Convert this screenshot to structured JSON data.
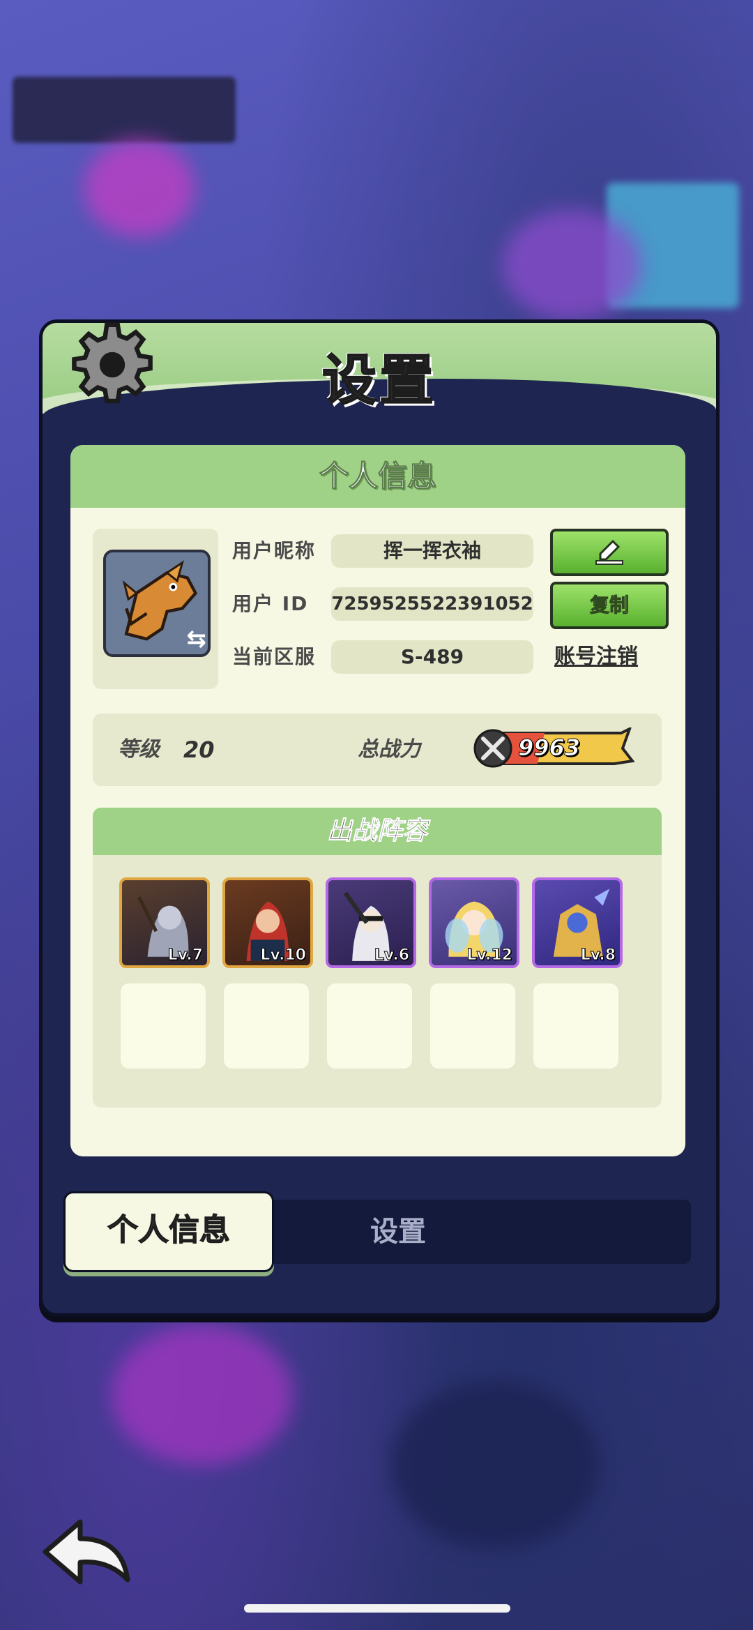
{
  "panel": {
    "title": "设置"
  },
  "personal_info": {
    "header": "个人信息",
    "nickname_label": "用户昵称",
    "nickname_value": "挥一挥衣袖",
    "id_label": "用户 ID",
    "id_value": "7259525522391052",
    "copy_button": "复制",
    "server_label": "当前区服",
    "server_value": "S-489",
    "cancel_account": "账号注销"
  },
  "stats": {
    "level_label": "等级",
    "level_value": "20",
    "power_label": "总战力",
    "power_value": "9963"
  },
  "team": {
    "header": "出战阵容",
    "heroes": [
      {
        "level": "Lv.7",
        "rarity": "gold"
      },
      {
        "level": "Lv.10",
        "rarity": "gold"
      },
      {
        "level": "Lv.6",
        "rarity": "purple"
      },
      {
        "level": "Lv.12",
        "rarity": "purple"
      },
      {
        "level": "Lv.8",
        "rarity": "purple"
      }
    ],
    "empty_slots": 5
  },
  "tabs": {
    "active": "个人信息",
    "inactive": "设置"
  },
  "icons": {
    "gear": "gear-icon",
    "edit": "pencil-icon",
    "back": "back-arrow-icon",
    "swap": "swap-icon",
    "power": "crossed-swords-icon"
  },
  "colors": {
    "accent_green": "#9fd187",
    "button_green": "#59b12f",
    "panel_dark": "#1e2550",
    "content_bg": "#f7f8e3"
  }
}
